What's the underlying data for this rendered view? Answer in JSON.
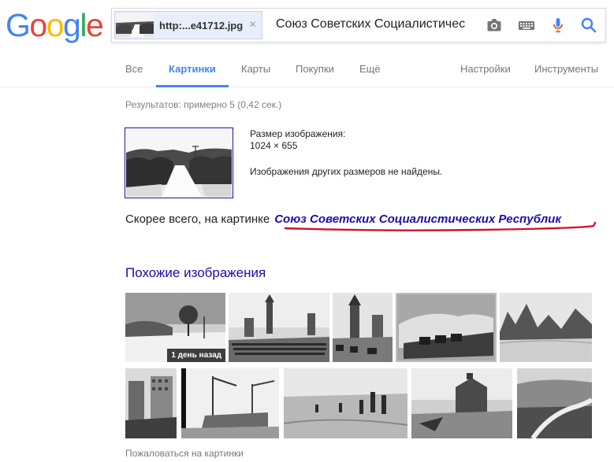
{
  "logo": {
    "letters": [
      "G",
      "o",
      "o",
      "g",
      "l",
      "e"
    ],
    "colors": [
      "#4285f4",
      "#ea4335",
      "#fbbc05",
      "#4285f4",
      "#34a853",
      "#ea4335"
    ]
  },
  "search": {
    "image_chip": "http:...e41712.jpg",
    "chip_close": "×",
    "query": "Союз Советских Социалистичес",
    "icons": [
      "camera-icon",
      "keyboard-icon",
      "microphone-icon",
      "search-icon"
    ]
  },
  "tabs": {
    "all": "Все",
    "images": "Картинки",
    "maps": "Карты",
    "shopping": "Покупки",
    "more": "Ещё",
    "settings": "Настройки",
    "tools": "Инструменты"
  },
  "results": {
    "stats": "Результатов: примерно 5 (0,42 сек.)",
    "size_label": "Размер изображения:",
    "size_value": "1024 × 655",
    "no_other_sizes": "Изображения других размеров не найдены.",
    "guess_prefix": "Скорее всего, на картинке",
    "guess_link": "Союз Советских Социалистических Республик"
  },
  "similar": {
    "heading": "Похожие изображения",
    "badge": "1 день назад",
    "report": "Пожаловаться на картинки"
  },
  "colors": {
    "link": "#1a0dab",
    "accent": "#4285f4",
    "annotation": "#d0102a"
  }
}
